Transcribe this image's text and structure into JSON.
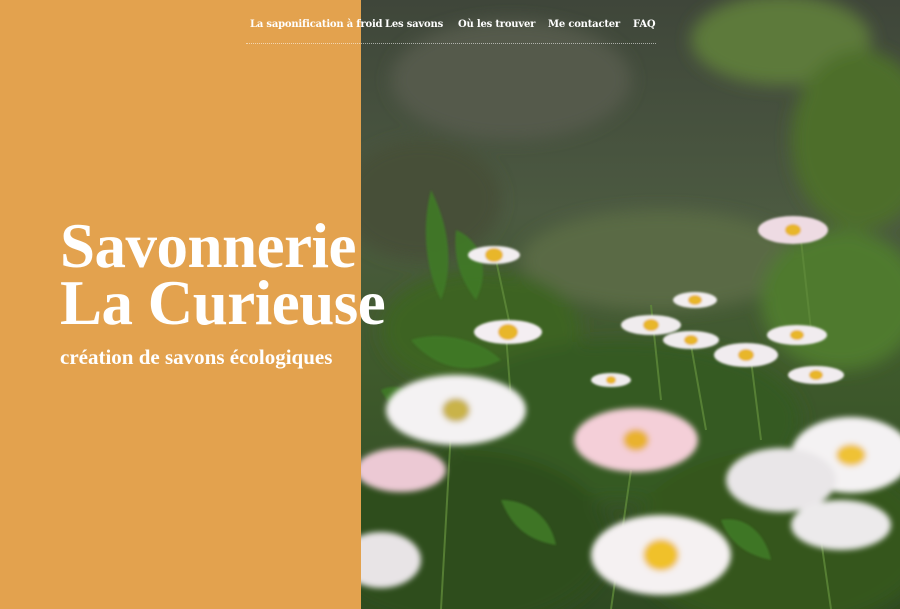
{
  "nav": {
    "items": [
      {
        "label": "La saponification à froid"
      },
      {
        "label": "Les savons"
      },
      {
        "label": "Où les trouver"
      },
      {
        "label": "Me contacter"
      },
      {
        "label": "FAQ"
      }
    ]
  },
  "hero": {
    "title_line1": "Savonnerie",
    "title_line2": "La Curieuse",
    "subtitle": "création de savons écologiques"
  },
  "colors": {
    "accent": "#E3A24E",
    "text": "#FFFFFF"
  }
}
